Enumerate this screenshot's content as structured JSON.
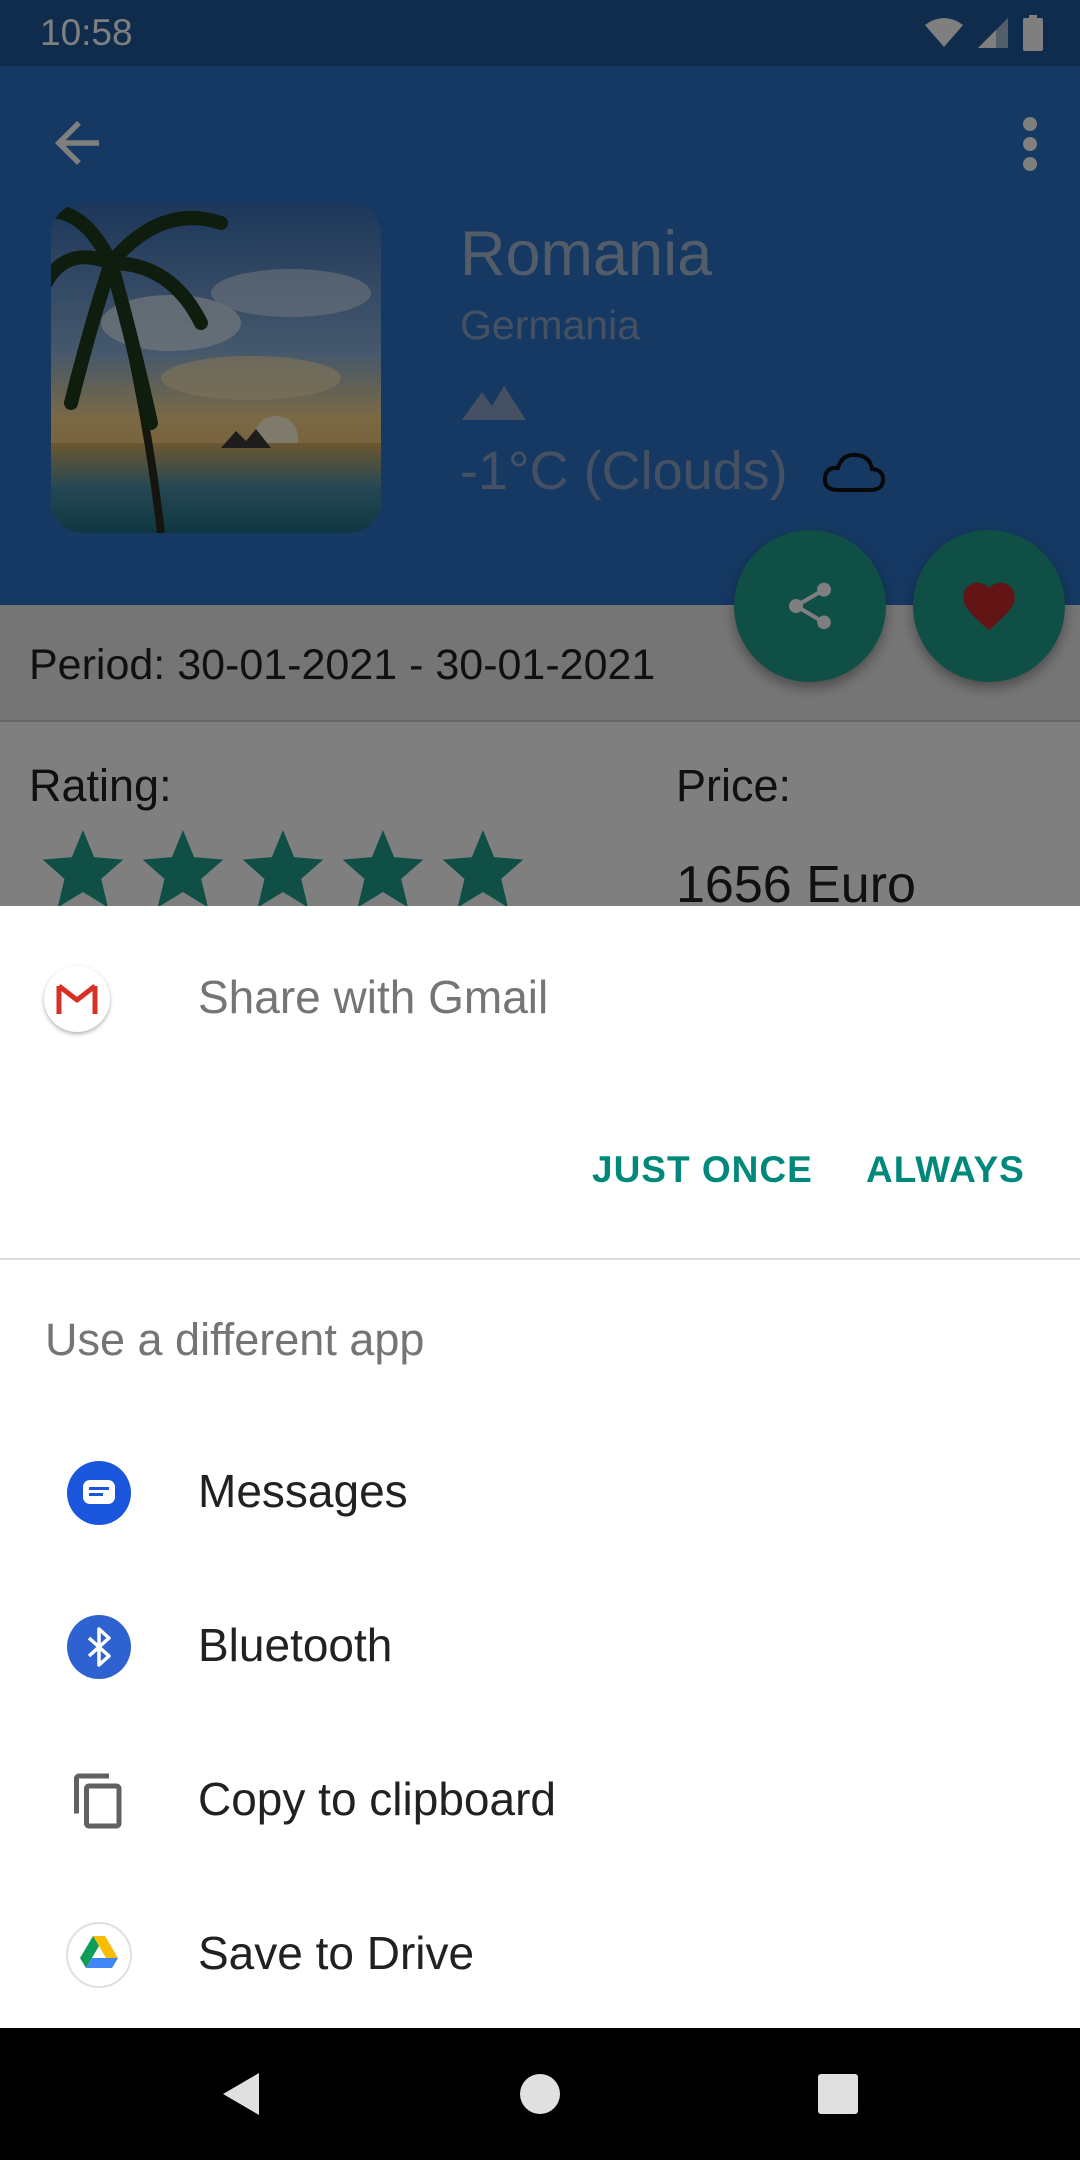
{
  "status_bar": {
    "time": "10:58"
  },
  "destination": {
    "title": "Romania",
    "origin": "Germania",
    "weather": "-1°C (Clouds)",
    "period": "Period: 30-01-2021 - 30-01-2021",
    "rating_label": "Rating:",
    "rating_stars": 5,
    "price_label": "Price:",
    "price_value": "1656 Euro"
  },
  "colors": {
    "header_bg": "#2a72c6",
    "fab_bg": "#1f9e8a",
    "accent_text": "#00897b",
    "favorite_heart": "#c62828"
  },
  "share_sheet": {
    "suggested_app": "Share with Gmail",
    "just_once": "JUST ONCE",
    "always": "ALWAYS",
    "different_app_label": "Use a different app",
    "apps": [
      {
        "label": "Messages",
        "icon": "messages-icon"
      },
      {
        "label": "Bluetooth",
        "icon": "bluetooth-icon"
      },
      {
        "label": "Copy to clipboard",
        "icon": "clipboard-icon"
      },
      {
        "label": "Save to Drive",
        "icon": "drive-icon"
      }
    ]
  },
  "nav_bar": {
    "icons": [
      "back-icon",
      "home-icon",
      "recents-icon"
    ]
  }
}
